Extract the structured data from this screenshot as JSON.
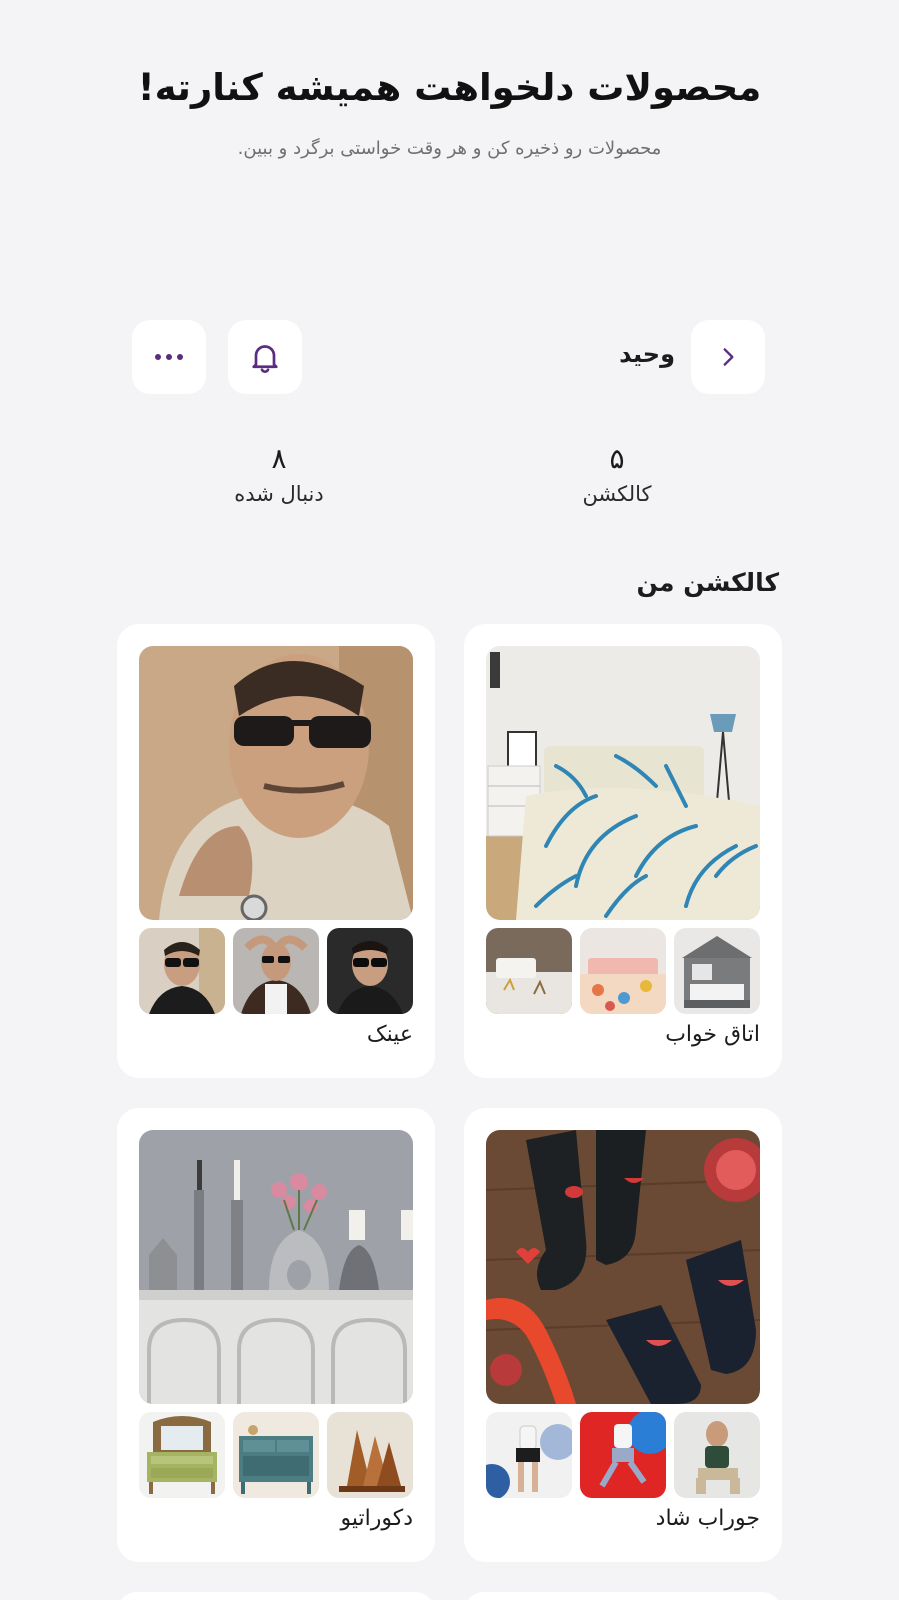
{
  "hero": {
    "title": "محصولات دلخواهت همیشه کنارته!",
    "subtitle": "محصولات رو ذخیره کن و هر وقت خواستی برگرد و ببین."
  },
  "header": {
    "user_name": "وحید",
    "back_icon": "chevron-right-icon",
    "bell_icon": "bell-icon",
    "more_icon": "more-horizontal-icon"
  },
  "stats": {
    "collections_value": "۵",
    "collections_label": "کالکشن",
    "following_value": "۸",
    "following_label": "دنبال شده"
  },
  "section": {
    "title": "کالکشن من"
  },
  "collections": [
    {
      "label": "اتاق خواب"
    },
    {
      "label": "عینک"
    },
    {
      "label": "جوراب شاد"
    },
    {
      "label": "دکوراتیو"
    }
  ],
  "colors": {
    "accent": "#5b2d82",
    "background": "#f4f4f6",
    "card": "#ffffff"
  }
}
